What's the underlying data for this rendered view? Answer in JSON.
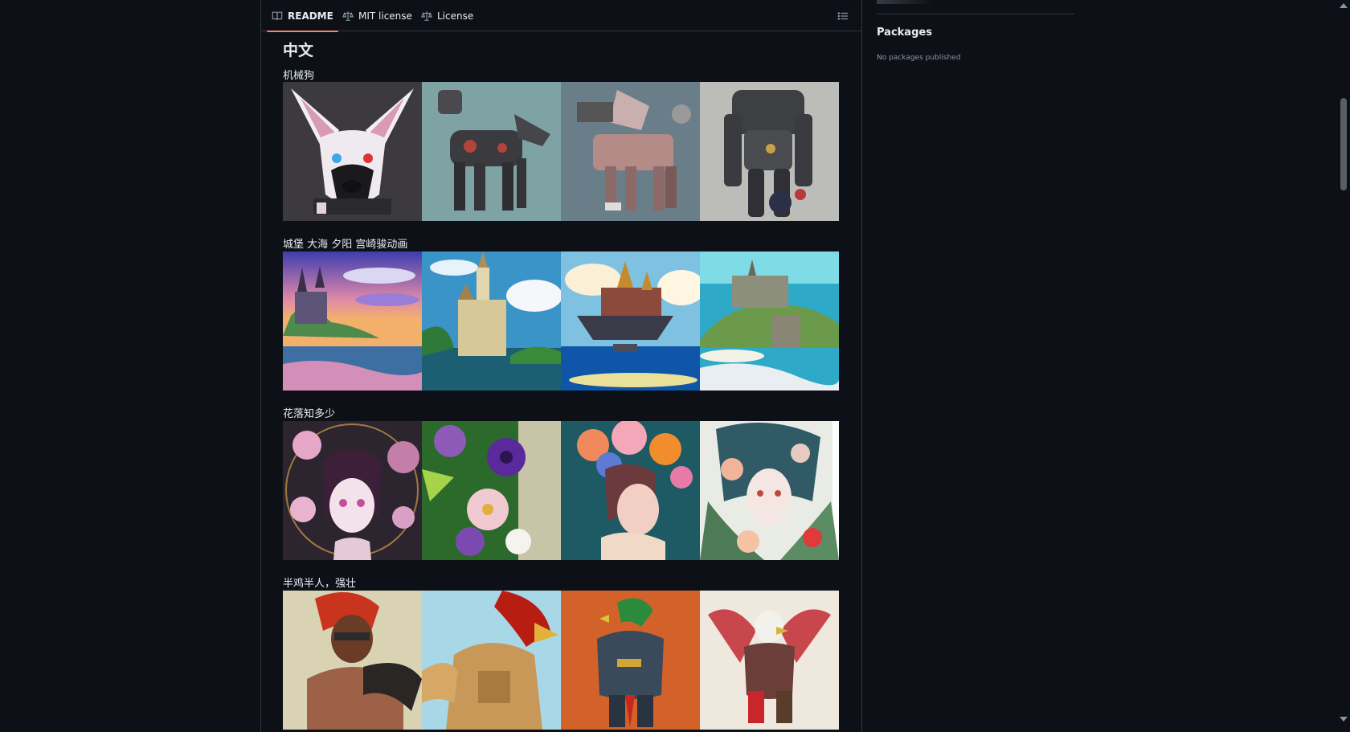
{
  "tabs": [
    {
      "label": "README",
      "icon": "book-icon",
      "active": true
    },
    {
      "label": "MIT license",
      "icon": "law-icon",
      "active": false
    },
    {
      "label": "License",
      "icon": "law-icon",
      "active": false
    }
  ],
  "toc_icon": "list-unordered-icon",
  "readme": {
    "heading": "中文",
    "sections": [
      {
        "label": "机械狗",
        "images": [
          "robot-dog-face-image",
          "robot-dog-side-image",
          "robot-dog-pink-image",
          "robot-dog-standing-image"
        ]
      },
      {
        "label": "城堡 大海 夕阳 宫崎骏动画",
        "images": [
          "castle-sunset-image",
          "castle-sea-image",
          "castle-cliff-image",
          "castle-coast-image"
        ]
      },
      {
        "label": "花落知多少",
        "images": [
          "flower-girl-purple-image",
          "flower-bouquet-image",
          "flower-girl-orange-image",
          "flower-girl-teal-image"
        ]
      },
      {
        "label": "半鸡半人，强壮",
        "images": [
          "chicken-warrior-1-image",
          "chicken-warrior-2-image",
          "chicken-warrior-3-image",
          "chicken-warrior-4-image"
        ]
      }
    ]
  },
  "sidebar": {
    "packages_title": "Packages",
    "packages_empty": "No packages published"
  },
  "colors": {
    "background": "#0d1117",
    "border": "#30363d",
    "active_tab_underline": "#f78166",
    "text": "#e6edf3",
    "muted": "#8b949e"
  }
}
